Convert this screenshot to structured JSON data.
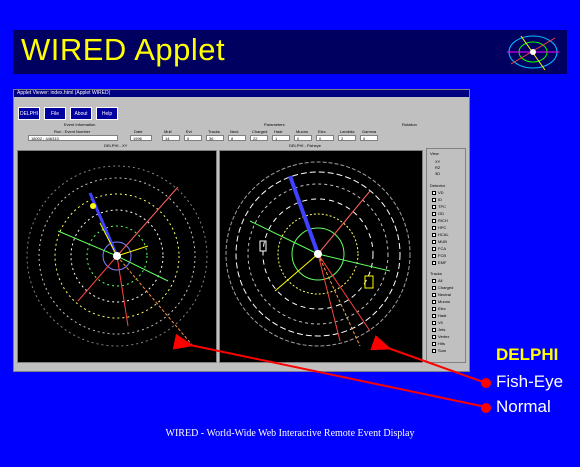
{
  "slide": {
    "title": "WIRED Applet",
    "footer": "WIRED - World-Wide Web Interactive Remote Event Display"
  },
  "labels": {
    "experiment": "DELPHI",
    "items": [
      "Fish-Eye",
      "Normal"
    ]
  },
  "applet": {
    "window_title": "Applet Viewer: index.html (Applet WIRED)",
    "buttons": [
      "DELPHI",
      "File",
      "About",
      "Help"
    ],
    "event_label": "Event Information",
    "run_label": "Run : Event Number",
    "run_value": "18002 : 446310",
    "file_label": "Date",
    "file_value": "1996",
    "stats_label": "Parameters",
    "stats_cols": [
      "Mult",
      "Evt",
      "Tracks",
      "Neut",
      "Charged",
      "Hadr",
      "Muons",
      "Elec",
      "Lambda",
      "Gamma"
    ],
    "stats_vals": [
      "14",
      "0",
      "36",
      "8",
      "22",
      "1",
      "0",
      "0",
      "2",
      "0"
    ],
    "rotation_label": "Rotation",
    "left_view_title": "DELPHI - XY",
    "right_view_title": "DELPHI - Fisheye",
    "side_header": "View",
    "side_options": [
      "XY",
      "RZ",
      "3D"
    ],
    "detector_label": "Detector",
    "detector_items": [
      "VD",
      "ID",
      "TPC",
      "OD",
      "RICH",
      "HPC",
      "HCAL",
      "MUB",
      "FCA",
      "FCB",
      "EMF"
    ],
    "tracks_label": "Tracks",
    "tracks_items": [
      "All",
      "Charged",
      "Neutral",
      "Muons",
      "Elec",
      "Hadr",
      "V0",
      "Jets",
      "Vertex",
      "Hits",
      "Sum"
    ]
  },
  "colors": {
    "background": "#0000ff",
    "title_bar": "#000060",
    "title_text": "#ffff00",
    "arrow": "#ff0000",
    "delphi": "#ffff00"
  }
}
